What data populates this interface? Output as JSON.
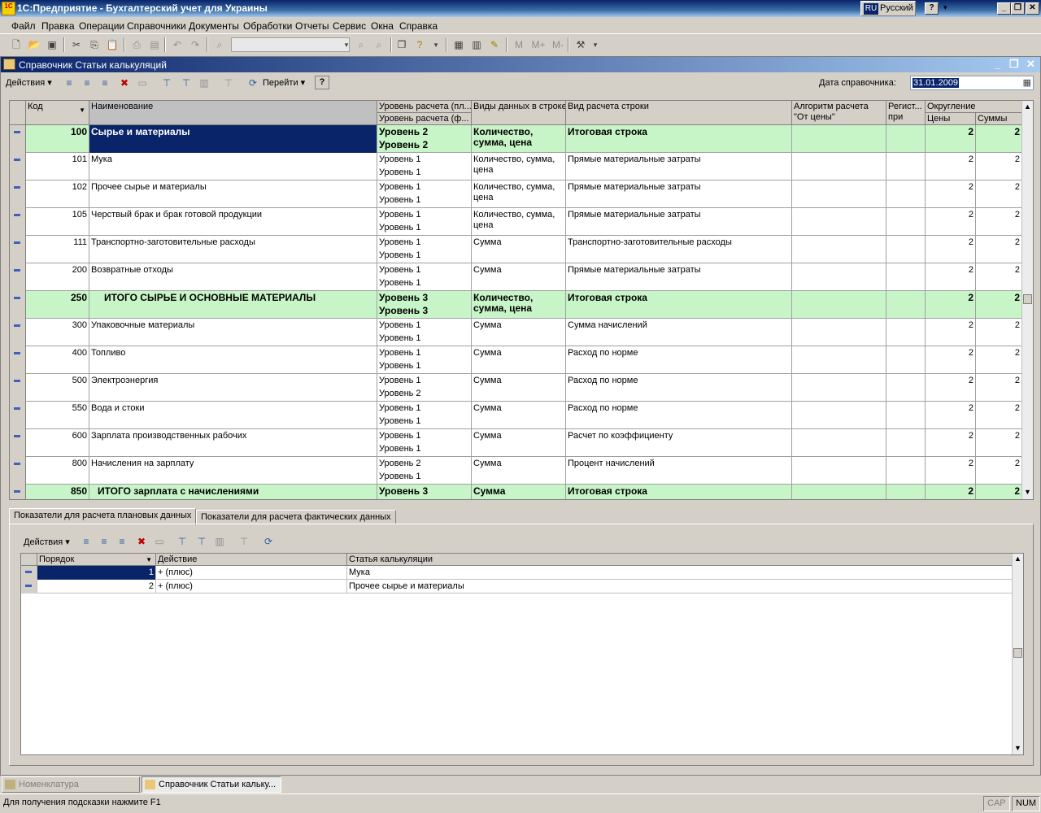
{
  "app": {
    "title": "1С:Предприятие - Бухгалтерский учет для Украины",
    "icon_text": "1C",
    "lang_code": "RU",
    "lang_name": "Русский"
  },
  "menu": [
    "Файл",
    "Правка",
    "Операции",
    "Справочники",
    "Документы",
    "Обработки",
    "Отчеты",
    "Сервис",
    "Окна",
    "Справка"
  ],
  "toolbar": {
    "icons": [
      "new-icon",
      "open-icon",
      "save-icon",
      "cut-icon",
      "copy-icon",
      "paste-icon",
      "print-icon",
      "preview-icon",
      "undo-icon",
      "redo-icon",
      "find-icon"
    ],
    "m_buttons": [
      "M",
      "M+",
      "M-"
    ]
  },
  "window": {
    "title": "Справочник Статьи калькуляций"
  },
  "formbar": {
    "actions_label": "Действия",
    "goto_label": "Перейти",
    "help_label": "?",
    "date_label": "Дата справочника:",
    "date_value": "31.01.2009"
  },
  "grid": {
    "headers": {
      "code": "Код",
      "name": "Наименование",
      "level_plan": "Уровень расчета (пл...",
      "level_fact": "Уровень расчета (ф...",
      "data_kinds": "Виды данных в строке",
      "calc_kind": "Вид расчета строки",
      "algorithm": "Алгоритм расчета \"От цены\"",
      "register": "Регист... при",
      "rounding": "Округление",
      "price": "Цены",
      "sum": "Суммы"
    },
    "rows": [
      {
        "code": "100",
        "name": "Сырье и материалы",
        "lvl1": "Уровень 2",
        "lvl2": "Уровень 2",
        "kinds": "Количество, сумма, цена",
        "calc": "Итоговая строка",
        "price": "2",
        "sum": "2",
        "group": true
      },
      {
        "code": "101",
        "name": "Мука",
        "lvl1": "Уровень 1",
        "lvl2": "Уровень 1",
        "kinds": "Количество, сумма, цена",
        "calc": "Прямые материальные затраты",
        "price": "2",
        "sum": "2",
        "group": false
      },
      {
        "code": "102",
        "name": "Прочее сырье и материалы",
        "lvl1": "Уровень 1",
        "lvl2": "Уровень 1",
        "kinds": "Количество, сумма, цена",
        "calc": "Прямые материальные затраты",
        "price": "2",
        "sum": "2",
        "group": false
      },
      {
        "code": "105",
        "name": "Черствый брак и брак готовой продукции",
        "lvl1": "Уровень 1",
        "lvl2": "Уровень 1",
        "kinds": "Количество, сумма, цена",
        "calc": "Прямые материальные затраты",
        "price": "2",
        "sum": "2",
        "group": false
      },
      {
        "code": "111",
        "name": "Транспортно-заготовительные расходы",
        "lvl1": "Уровень 1",
        "lvl2": "Уровень 1",
        "kinds": "Сумма",
        "calc": "Транспортно-заготовительные расходы",
        "price": "2",
        "sum": "2",
        "group": false
      },
      {
        "code": "200",
        "name": "Возвратные отходы",
        "lvl1": "Уровень 1",
        "lvl2": "Уровень 1",
        "kinds": "Сумма",
        "calc": "Прямые материальные затраты",
        "price": "2",
        "sum": "2",
        "group": false
      },
      {
        "code": "250",
        "name": "ИТОГО СЫРЬЕ И ОСНОВНЫЕ МАТЕРИАЛЫ",
        "lvl1": "Уровень 3",
        "lvl2": "Уровень 3",
        "kinds": "Количество, сумма, цена",
        "calc": "Итоговая строка",
        "price": "2",
        "sum": "2",
        "group": true
      },
      {
        "code": "300",
        "name": "Упаковочные материалы",
        "lvl1": "Уровень 1",
        "lvl2": "Уровень 1",
        "kinds": "Сумма",
        "calc": "Сумма начислений",
        "price": "2",
        "sum": "2",
        "group": false
      },
      {
        "code": "400",
        "name": "Топливо",
        "lvl1": "Уровень 1",
        "lvl2": "Уровень 1",
        "kinds": "Сумма",
        "calc": "Расход по норме",
        "price": "2",
        "sum": "2",
        "group": false
      },
      {
        "code": "500",
        "name": "Электроэнергия",
        "lvl1": "Уровень 1",
        "lvl2": "Уровень 2",
        "kinds": "Сумма",
        "calc": "Расход по норме",
        "price": "2",
        "sum": "2",
        "group": false
      },
      {
        "code": "550",
        "name": "Вода и стоки",
        "lvl1": "Уровень 1",
        "lvl2": "Уровень 1",
        "kinds": "Сумма",
        "calc": "Расход по норме",
        "price": "2",
        "sum": "2",
        "group": false
      },
      {
        "code": "600",
        "name": "Зарплата производственных рабочих",
        "lvl1": "Уровень 1",
        "lvl2": "Уровень 1",
        "kinds": "Сумма",
        "calc": "Расчет по коэффициенту",
        "price": "2",
        "sum": "2",
        "group": false
      },
      {
        "code": "800",
        "name": "Начисления на зарплату",
        "lvl1": "Уровень 2",
        "lvl2": "Уровень 1",
        "kinds": "Сумма",
        "calc": "Процент начислений",
        "price": "2",
        "sum": "2",
        "group": false
      },
      {
        "code": "850",
        "name": "ИТОГО зарплата с начислениями",
        "lvl1": "Уровень 3",
        "lvl2": "",
        "kinds": "Сумма",
        "calc": "Итоговая строка",
        "price": "2",
        "sum": "2",
        "group": true
      }
    ]
  },
  "tabs": [
    "Показатели для расчета плановых данных",
    "Показатели для расчета фактических данных"
  ],
  "subform": {
    "actions_label": "Действия"
  },
  "subgrid": {
    "headers": {
      "order": "Порядок",
      "action": "Действие",
      "item": "Статья калькуляции"
    },
    "rows": [
      {
        "order": "1",
        "action": "+ (плюс)",
        "item": "Мука"
      },
      {
        "order": "2",
        "action": "+ (плюс)",
        "item": "Прочее сырье и материалы"
      }
    ]
  },
  "taskbar": [
    "Номенклатура",
    "Справочник Статьи кальку..."
  ],
  "status": {
    "hint": "Для получения подсказки нажмите F1",
    "cap": "CAP",
    "num": "NUM"
  },
  "colors": {
    "group_row": "#c8f5c8",
    "title_dark": "#0a246a",
    "selection": "#0a246a"
  }
}
